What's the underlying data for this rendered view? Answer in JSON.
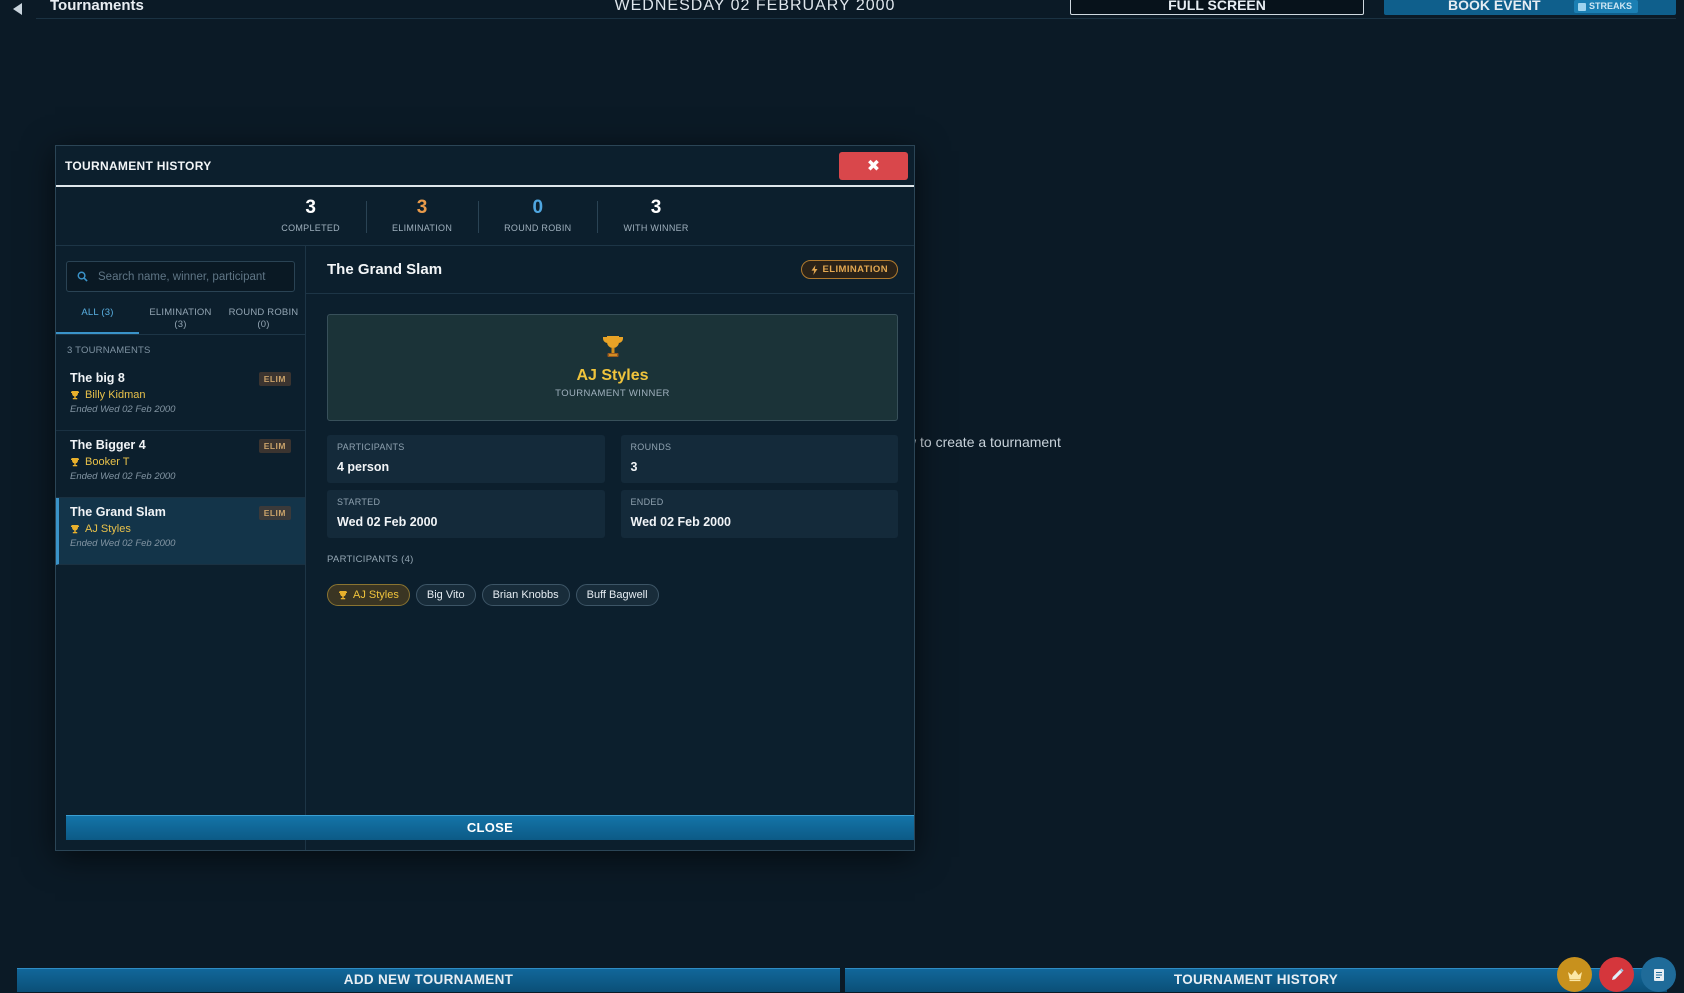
{
  "topbar": {
    "title": "Tournaments",
    "date": "WEDNESDAY 02 FEBRUARY 2000",
    "fullscreen_label": "FULL SCREEN",
    "book_event_label": "BOOK EVENT",
    "streaks_label": "STREAKS"
  },
  "background_hint": "w to create a tournament",
  "modal": {
    "title": "TOURNAMENT HISTORY",
    "close_x": "✖",
    "stats": [
      {
        "value": "3",
        "label": "COMPLETED",
        "color": "#ffffff"
      },
      {
        "value": "3",
        "label": "ELIMINATION",
        "color": "#e89a4a"
      },
      {
        "value": "0",
        "label": "ROUND ROBIN",
        "color": "#4fa6e0"
      },
      {
        "value": "3",
        "label": "WITH WINNER",
        "color": "#ffffff"
      }
    ],
    "search_placeholder": "Search name, winner, participant",
    "filter_tabs": [
      {
        "label": "ALL (3)"
      },
      {
        "label": "ELIMINATION",
        "count": "(3)"
      },
      {
        "label": "ROUND ROBIN",
        "count": "(0)"
      }
    ],
    "list_count": "3 TOURNAMENTS",
    "tournaments": [
      {
        "name": "The big 8",
        "winner": "Billy Kidman",
        "ended": "Ended Wed 02 Feb 2000",
        "badge": "ELIM"
      },
      {
        "name": "The Bigger 4",
        "winner": "Booker T",
        "ended": "Ended Wed 02 Feb 2000",
        "badge": "ELIM"
      },
      {
        "name": "The Grand Slam",
        "winner": "AJ Styles",
        "ended": "Ended Wed 02 Feb 2000",
        "badge": "ELIM"
      }
    ],
    "detail": {
      "title": "The Grand Slam",
      "type": "ELIMINATION",
      "winner": "AJ Styles",
      "winner_label": "TOURNAMENT WINNER",
      "info": {
        "participants_label": "PARTICIPANTS",
        "participants_value": "4 person",
        "rounds_label": "ROUNDS",
        "rounds_value": "3",
        "started_label": "STARTED",
        "started_value": "Wed 02 Feb 2000",
        "ended_label": "ENDED",
        "ended_value": "Wed 02 Feb 2000"
      },
      "participants_title": "PARTICIPANTS (4)",
      "participants": [
        "AJ Styles",
        "Big Vito",
        "Brian Knobbs",
        "Buff Bagwell"
      ]
    },
    "close_label": "CLOSE"
  },
  "bottom": {
    "add_label": "ADD NEW TOURNAMENT",
    "history_label": "TOURNAMENT HISTORY"
  },
  "colors": {
    "accent": "#1474a8",
    "danger": "#d9474b",
    "gold": "#f0c43c"
  },
  "icons": [
    "back-arrow-icon",
    "search-icon",
    "trophy-icon",
    "lightning-icon",
    "close-icon",
    "crown-icon",
    "pencil-icon",
    "notes-icon"
  ]
}
